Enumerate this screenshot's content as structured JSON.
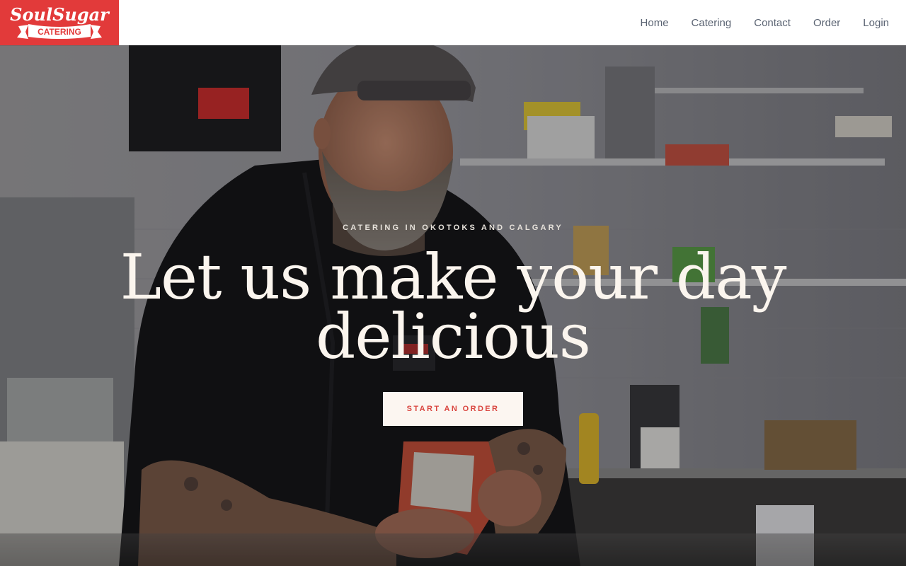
{
  "brand": {
    "logo_script": "SoulSugar",
    "logo_banner": "CATERING",
    "color": "#e23a3a"
  },
  "nav": {
    "items": [
      "Home",
      "Catering",
      "Contact",
      "Order",
      "Login"
    ]
  },
  "hero": {
    "eyebrow": "CATERING IN OKOTOKS AND CALGARY",
    "headline_line1": "Let us make your day",
    "headline_line2": "delicious",
    "cta_label": "START AN ORDER",
    "cta_text_color": "#d9443e"
  }
}
